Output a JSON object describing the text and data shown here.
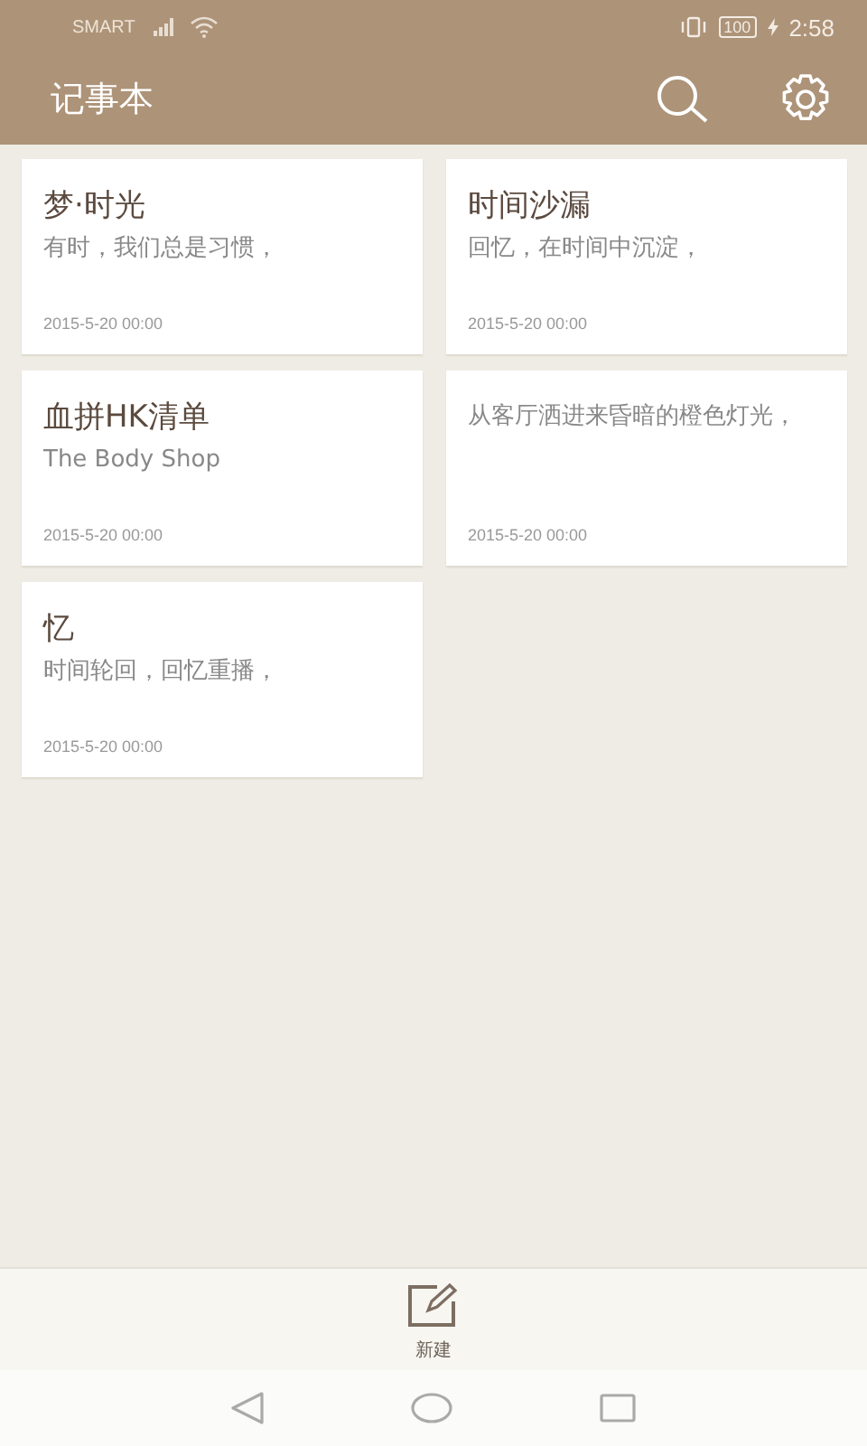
{
  "status_bar": {
    "carrier": "SMART",
    "battery": "100",
    "time": "2:58"
  },
  "app_bar": {
    "title": "记事本"
  },
  "notes": [
    {
      "title": "梦·时光",
      "preview": "有时，我们总是习惯，",
      "date": "2015-5-20 00:00"
    },
    {
      "title": "时间沙漏",
      "preview": "回忆，在时间中沉淀，",
      "date": "2015-5-20 00:00"
    },
    {
      "title": "血拼HK清单",
      "preview": "The Body Shop",
      "date": "2015-5-20 00:00"
    },
    {
      "preview": "从客厅洒进来昏暗的橙色灯光，",
      "date": "2015-5-20 00:00"
    },
    {
      "title": "忆",
      "preview": "时间轮回，回忆重播，",
      "date": "2015-5-20 00:00"
    }
  ],
  "bottom_action": {
    "label": "新建"
  }
}
